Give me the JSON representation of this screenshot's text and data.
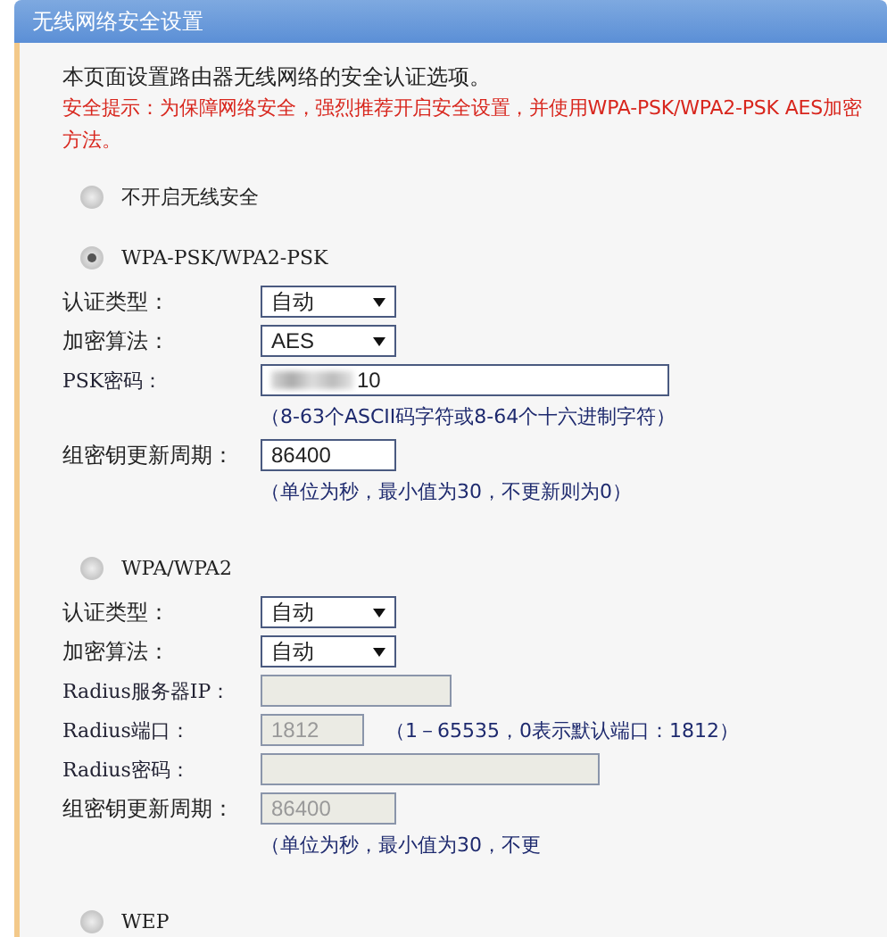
{
  "title": "无线网络安全设置",
  "intro": "本页面设置路由器无线网络的安全认证选项。",
  "warning": "安全提示：为保障网络安全，强烈推荐开启安全设置，并使用WPA-PSK/WPA2-PSK AES加密方法。",
  "options": [
    {
      "label": "不开启无线安全",
      "selected": false
    },
    {
      "label": "WPA-PSK/WPA2-PSK",
      "selected": true,
      "fields": [
        {
          "kind": "select",
          "label": "认证类型：",
          "value": "自动",
          "disabled": false
        },
        {
          "kind": "select",
          "label": "加密算法：",
          "value": "AES",
          "disabled": false
        },
        {
          "kind": "input_long",
          "label": "PSK密码：",
          "value": "10",
          "redacted": true,
          "disabled": false,
          "hint": "（8-63个ASCII码字符或8-64个十六进制字符）"
        },
        {
          "kind": "input_medium",
          "label": "组密钥更新周期：",
          "value": "86400",
          "disabled": false,
          "hint": "（单位为秒，最小值为30，不更新则为0）"
        }
      ]
    },
    {
      "label": "WPA/WPA2",
      "selected": false,
      "fields": [
        {
          "kind": "select",
          "label": "认证类型：",
          "value": "自动",
          "disabled": false
        },
        {
          "kind": "select",
          "label": "加密算法：",
          "value": "自动",
          "disabled": false
        },
        {
          "kind": "input_ip",
          "label": "Radius服务器IP：",
          "disabled": true
        },
        {
          "kind": "input_short",
          "label": "Radius端口：",
          "value": "1812",
          "disabled": true,
          "inline_hint": "（1－65535，0表示默认端口：1812）"
        },
        {
          "kind": "input_pw",
          "label": "Radius密码：",
          "disabled": true
        },
        {
          "kind": "input_medium",
          "label": "组密钥更新周期：",
          "value": "86400",
          "disabled": true,
          "hint": "（单位为秒，最小值为30，不更"
        }
      ]
    },
    {
      "label": "WEP",
      "selected": false
    }
  ]
}
